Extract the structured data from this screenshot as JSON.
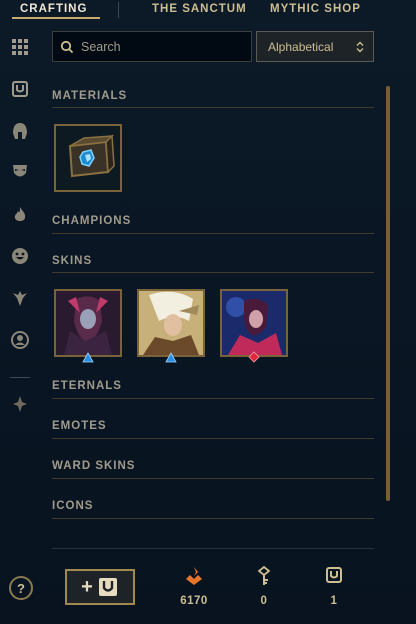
{
  "nav": {
    "tabs": [
      {
        "label": "CRAFTING",
        "active": true
      },
      {
        "label": "THE SANCTUM",
        "active": false
      },
      {
        "label": "MYTHIC SHOP",
        "active": false
      }
    ]
  },
  "sidebar": {
    "icons": [
      "grid-icon",
      "chest-icon",
      "helmet-icon",
      "mask-icon",
      "flame-icon",
      "emote-icon",
      "ward-icon",
      "profile-icon",
      "eternals-icon"
    ]
  },
  "search": {
    "placeholder": "Search",
    "value": ""
  },
  "sort": {
    "selected": "Alphabetical"
  },
  "sections": {
    "materials": "MATERIALS",
    "champions": "CHAMPIONS",
    "skins": "SKINS",
    "eternals": "ETERNALS",
    "emotes": "EMOTES",
    "ward_skins": "WARD SKINS",
    "icons": "ICONS"
  },
  "footer": {
    "help": "?",
    "craft_button_label": "+",
    "currencies": [
      {
        "icon": "blue-essence-icon",
        "amount": "6170"
      },
      {
        "icon": "key-icon",
        "amount": "0"
      },
      {
        "icon": "chest-icon",
        "amount": "1"
      }
    ]
  },
  "colors": {
    "gold": "#c8aa6e",
    "background": "#0a1624",
    "text": "#a09b8c",
    "essence_orange": "#e8742a",
    "gem_blue": "#2a8ee0",
    "gem_red": "#e0283c"
  }
}
